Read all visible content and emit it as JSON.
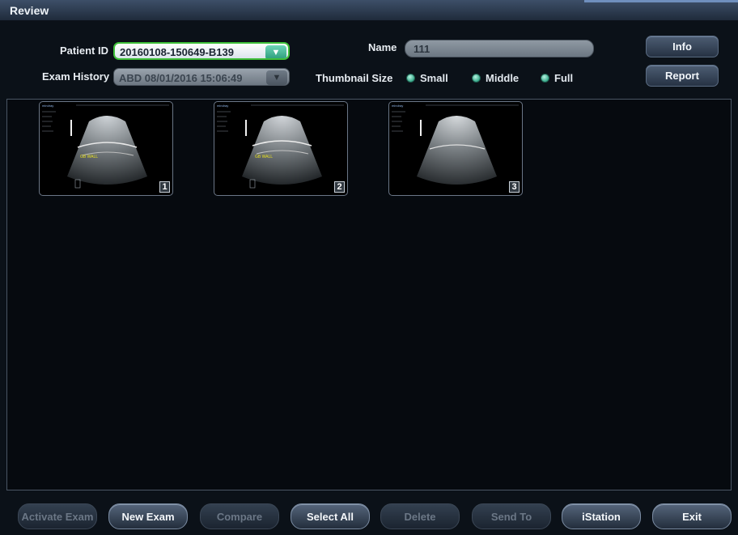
{
  "window": {
    "title": "Review"
  },
  "header": {
    "patient_id_label": "Patient ID",
    "patient_id_value": "20160108-150649-B139",
    "exam_history_label": "Exam History",
    "exam_history_value": "ABD 08/01/2016 15:06:49",
    "name_label": "Name",
    "name_value": "111",
    "thumbnail_size_label": "Thumbnail Size",
    "thumbnail_sizes": [
      "Small",
      "Middle",
      "Full"
    ],
    "info_label": "Info",
    "report_label": "Report"
  },
  "thumbnails": [
    {
      "number": "1",
      "header_text": "mindray",
      "marker_text": "GB WALL"
    },
    {
      "number": "2",
      "header_text": "mindray",
      "marker_text": "GB WALL"
    },
    {
      "number": "3",
      "header_text": "mindray",
      "marker_text": ""
    }
  ],
  "footer": {
    "buttons": [
      {
        "label": "Activate Exam",
        "enabled": false
      },
      {
        "label": "New Exam",
        "enabled": true
      },
      {
        "label": "Compare",
        "enabled": false
      },
      {
        "label": "Select All",
        "enabled": true
      },
      {
        "label": "Delete",
        "enabled": false
      },
      {
        "label": "Send To",
        "enabled": false
      },
      {
        "label": "iStation",
        "enabled": true
      },
      {
        "label": "Exit",
        "enabled": true
      }
    ]
  },
  "colors": {
    "accent_green": "#3fbf3a",
    "radio_teal": "#38a88a",
    "marker_yellow": "#e8e020"
  },
  "icons": {
    "dropdown": "chevron-down-icon",
    "radio": "radio-dot-icon"
  }
}
